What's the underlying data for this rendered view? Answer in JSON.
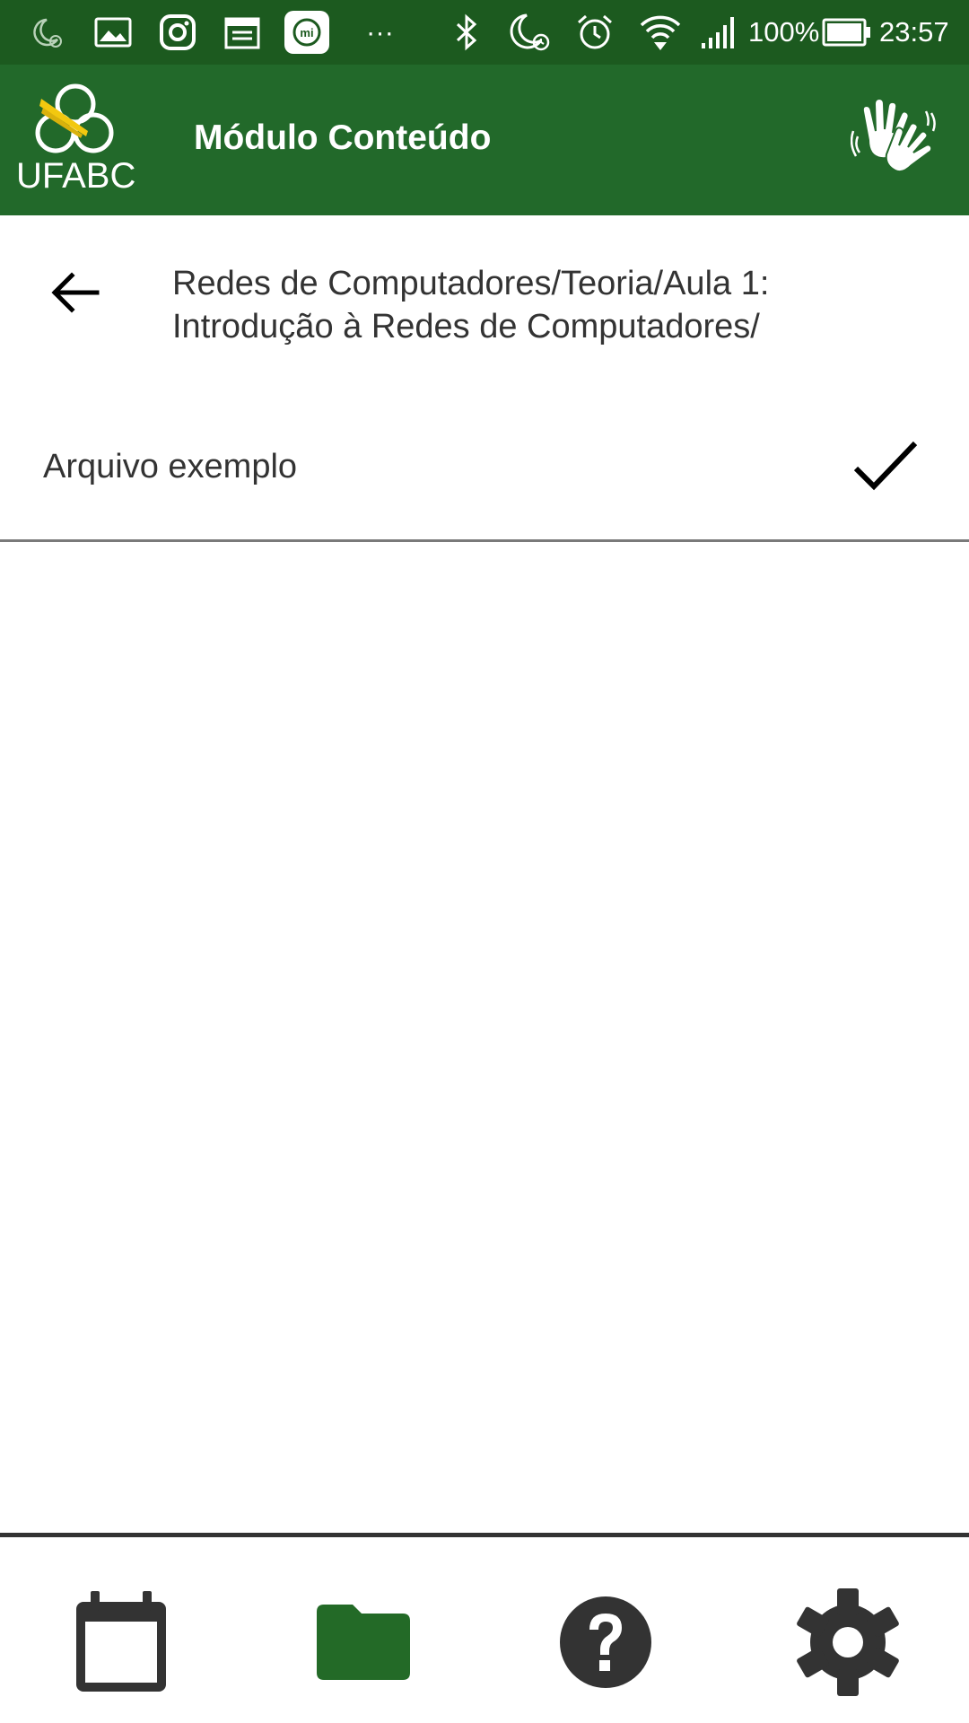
{
  "status_bar": {
    "battery_percent": "100%",
    "time": "23:57",
    "more_indicator": "···",
    "left_icons": [
      "moon-alarm-icon",
      "gallery-icon",
      "instagram-icon",
      "calendar-icon",
      "mi-icon"
    ],
    "right_icons": [
      "bluetooth-icon",
      "moon-alarm-icon",
      "alarm-icon",
      "wifi-icon",
      "signal-icon",
      "battery-icon"
    ]
  },
  "app_bar": {
    "logo_text": "UFABC",
    "title": "Módulo Conteúdo",
    "accessibility_icon": "sign-language-icon"
  },
  "breadcrumb": {
    "back_icon": "arrow-left-icon",
    "path": "Redes de Computadores/Teoria/Aula 1: Introdução à Redes de Computadores/"
  },
  "files": [
    {
      "name": "Arquivo exemplo",
      "status_icon": "check-icon"
    }
  ],
  "bottom_nav": {
    "items": [
      {
        "icon": "calendar-icon",
        "active": false
      },
      {
        "icon": "folder-icon",
        "active": true
      },
      {
        "icon": "help-icon",
        "active": false
      },
      {
        "icon": "settings-icon",
        "active": false
      }
    ]
  },
  "colors": {
    "status_bar": "#1c5a1f",
    "app_bar": "#22692a",
    "accent": "#236a27",
    "icon_dark": "#333333",
    "logo_yellow": "#f2c80f"
  }
}
